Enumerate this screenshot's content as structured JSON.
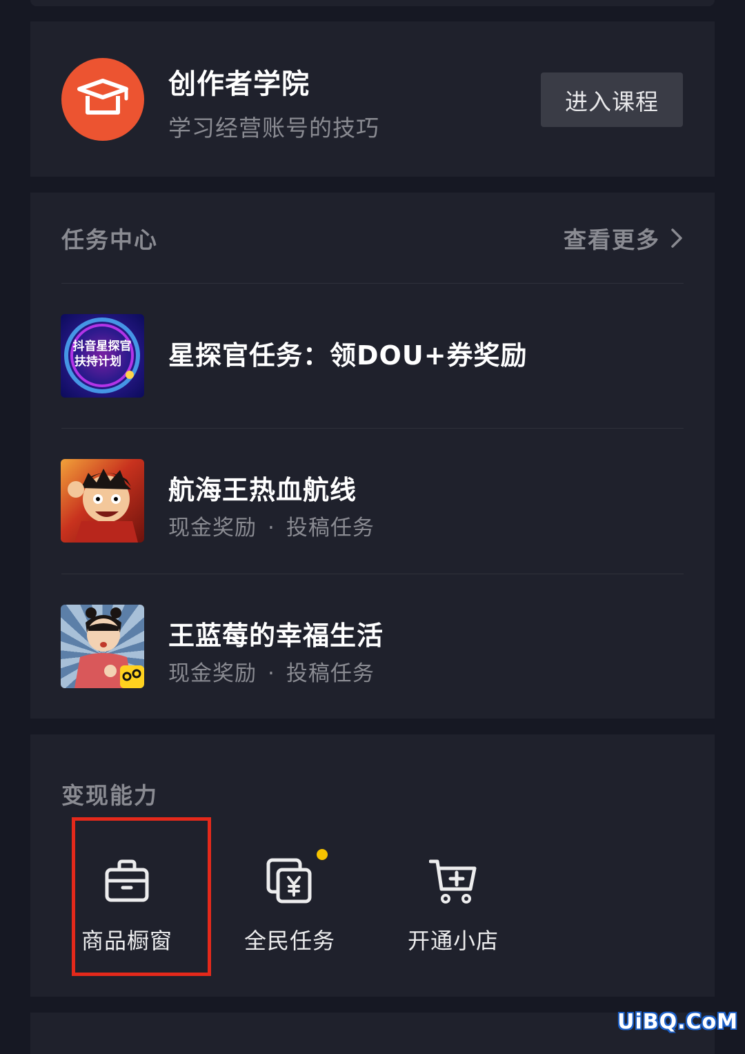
{
  "academy": {
    "title": "创作者学院",
    "subtitle": "学习经营账号的技巧",
    "enter_label": "进入课程",
    "logo_color": "#ec5431"
  },
  "task_center": {
    "title": "任务中心",
    "more_label": "查看更多",
    "items": [
      {
        "title": "星探官任务：领DOU+券奖励",
        "thumb_text": [
          "抖音星探官",
          "扶持计划"
        ]
      },
      {
        "title": "航海王热血航线",
        "meta": [
          "现金奖励",
          "投稿任务"
        ]
      },
      {
        "title": "王蓝莓的幸福生活",
        "meta": [
          "现金奖励",
          "投稿任务"
        ]
      }
    ],
    "separator": "·"
  },
  "monetization": {
    "title": "变现能力",
    "items": [
      {
        "label": "商品橱窗",
        "icon": "briefcase-icon"
      },
      {
        "label": "全民任务",
        "icon": "yuan-task-icon"
      },
      {
        "label": "开通小店",
        "icon": "cart-plus-icon"
      }
    ],
    "highlight_color": "#e4291b",
    "badge_color": "#f6c300"
  },
  "watermark": "UiBQ.CoM"
}
